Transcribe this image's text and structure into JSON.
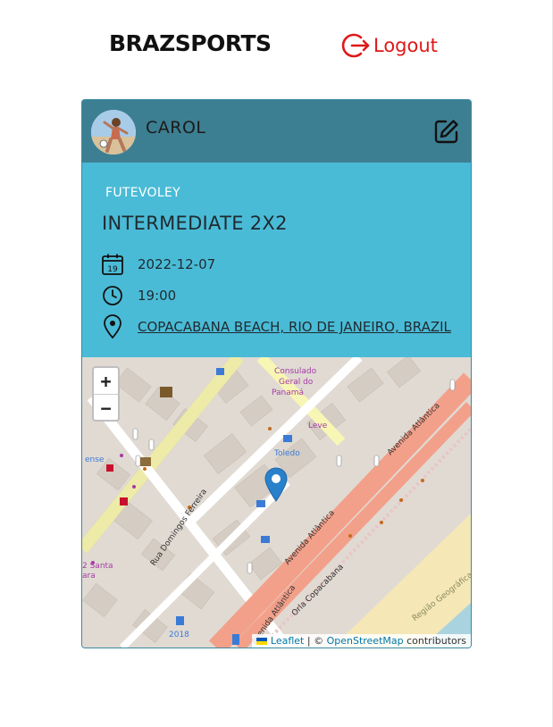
{
  "header": {
    "brand": "BRAZSPORTS",
    "logout_label": "Logout"
  },
  "event": {
    "owner_name": "CAROL",
    "category": "FUTEVOLEY",
    "title": "INTERMEDIATE 2X2",
    "date": "2022-12-07",
    "calendar_day": "19",
    "time": "19:00",
    "location": "COPACABANA BEACH, RIO DE JANEIRO, BRAZIL"
  },
  "map": {
    "zoom_in": "+",
    "zoom_out": "−",
    "attribution_leaflet": "Leaflet",
    "attribution_sep": " | © ",
    "attribution_osm": "OpenStreetMap",
    "attribution_tail": " contributors",
    "labels": {
      "consulado": "Consulado",
      "geral": "Geral do",
      "panama": "Panamá",
      "leve": "Leve",
      "toledo": "Toledo",
      "avenida1": "Avenida Atlântica",
      "avenida2": "Avenida Atlântica",
      "avenida3": "Avenida Atlântica",
      "rua": "Rua Domingos Ferreira",
      "orla": "Orla Copacabana",
      "santa1": "2 Santa",
      "santa2": "ara",
      "ense": "ense",
      "num2018": "2018",
      "regiao": "Região Geográfica Int"
    }
  },
  "colors": {
    "header_bg": "#3d7f92",
    "card_bg": "#4abbd6",
    "logout": "#e01818",
    "marker": "#2a81cb"
  }
}
